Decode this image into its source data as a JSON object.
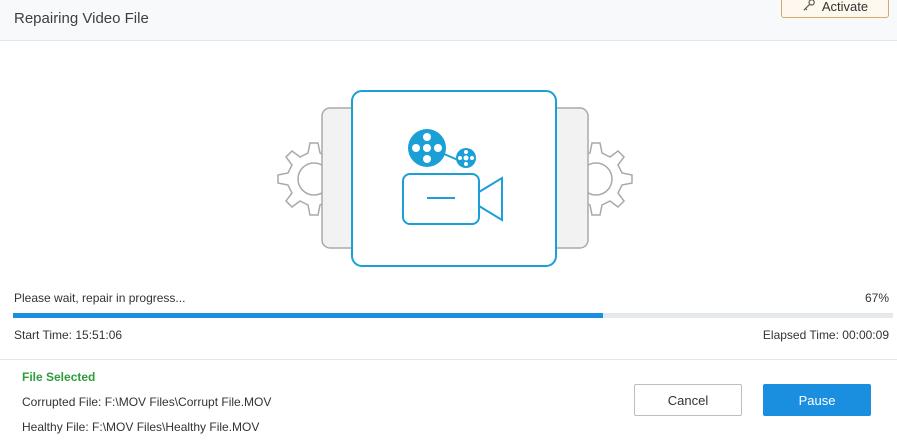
{
  "header": {
    "title": "Repairing Video File",
    "activate_label": "Activate",
    "activate_icon": "key-icon"
  },
  "illustration": {
    "icon": "video-camera-repair-icon",
    "accent_color": "#1aa0d6"
  },
  "progress": {
    "status": "Please wait, repair in progress...",
    "percent_label": "67%",
    "value": 0.67,
    "start_time": "Start Time:  15:51:06",
    "elapsed_time": "Elapsed Time:  00:00:09",
    "bar_color": "#1a8fe0"
  },
  "file_info": {
    "heading": "File Selected",
    "corrupted": "Corrupted File: F:\\MOV Files\\Corrupt File.MOV",
    "healthy": "Healthy File: F:\\MOV Files\\Healthy File.MOV",
    "heading_color": "#2e9e3c"
  },
  "actions": {
    "cancel_label": "Cancel",
    "pause_label": "Pause"
  }
}
